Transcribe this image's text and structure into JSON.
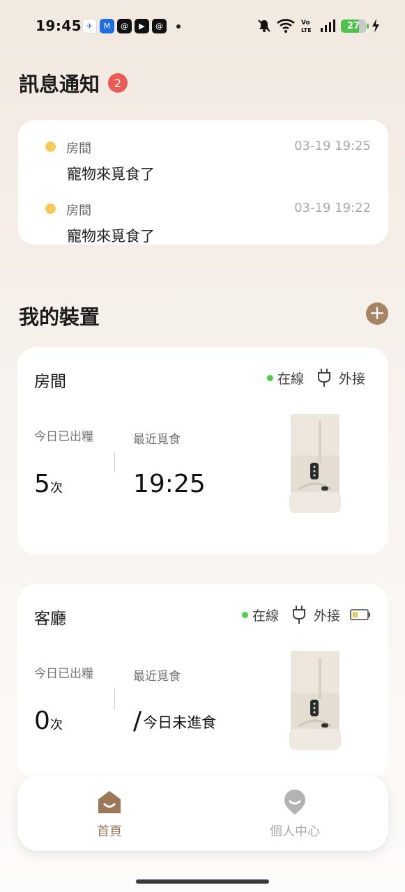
{
  "status_bar": {
    "time": "19:45",
    "battery": "27",
    "network": "VoLTE"
  },
  "notifications": {
    "title": "訊息通知",
    "badge_count": "2",
    "items": [
      {
        "device": "房間",
        "time": "03-19 19:25",
        "message": "寵物來覓食了"
      },
      {
        "device": "房間",
        "time": "03-19 19:22",
        "message": "寵物來覓食了"
      }
    ]
  },
  "devices": {
    "title": "我的裝置",
    "add_icon": "plus-icon",
    "items": [
      {
        "name": "房間",
        "status": "在線",
        "power": "外接",
        "fed_label": "今日已出糧",
        "fed_count": "5",
        "fed_unit": "次",
        "recent_label": "最近覓食",
        "recent_value": "19:25"
      },
      {
        "name": "客廳",
        "status": "在線",
        "power": "外接",
        "fed_label": "今日已出糧",
        "fed_count": "0",
        "fed_unit": "次",
        "recent_label": "最近覓食",
        "recent_slash": "/",
        "recent_value": "今日未進食"
      }
    ]
  },
  "nav": {
    "home": "首頁",
    "profile": "個人中心"
  },
  "colors": {
    "accent": "#a88466",
    "badge": "#ec5a55",
    "notif_dot": "#f8c95a",
    "online": "#4ad14a"
  }
}
